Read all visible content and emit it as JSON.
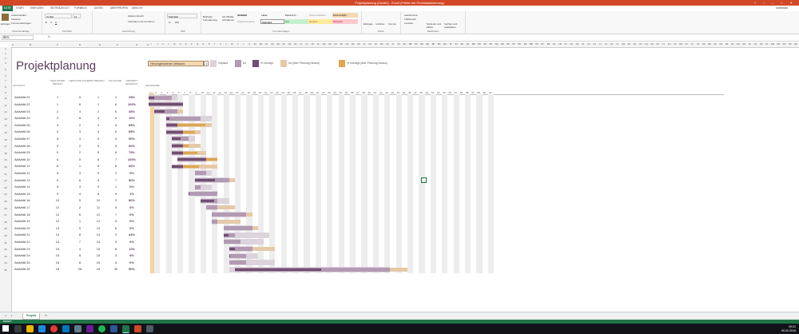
{
  "window": {
    "title": "Projektplanung (Gantt1) - Excel (Fehler bei Produktaktivierung)",
    "user": "damedaild"
  },
  "ribbon": {
    "tabs": [
      "DATEI",
      "START",
      "EINFÜGEN",
      "SEITENLAYOUT",
      "FORMELN",
      "DATEN",
      "ÜBERPRÜFEN",
      "ANSICHT"
    ],
    "active_tab": "START",
    "groups": [
      {
        "label": "Zwischenablage",
        "items": [
          "Einfügen",
          "Ausschneiden",
          "Kopieren",
          "Format übertragen"
        ]
      },
      {
        "label": "Schriftart",
        "items": [
          "Corbel",
          "11",
          "F",
          "K",
          "U"
        ]
      },
      {
        "label": "Ausrichtung",
        "items": [
          "Zeilenumbruch",
          "Verbinden und zentrieren"
        ]
      },
      {
        "label": "Zahl",
        "items": [
          "Standard",
          "%",
          "000"
        ]
      },
      {
        "label": "Formatvorlagen",
        "items": [
          "Bedingte Formatierung",
          "Als Tabelle formatieren"
        ]
      },
      {
        "label": "Zellen",
        "items": [
          "Einfügen",
          "Löschen",
          "Format"
        ]
      },
      {
        "label": "Bearbeiten",
        "items": [
          "AutoSumme",
          "Füllbereich",
          "Löschen",
          "Sortieren und Filtern",
          "Suchen und Auswählen"
        ]
      }
    ],
    "styles": [
      "Aktivität",
      "Label",
      "Percent C...",
      "Period Headers",
      "Period Highl...",
      "Projekt Headers",
      "Standard",
      "Gut",
      "Neutral",
      "Schlecht"
    ]
  },
  "formula_bar": {
    "name_box": "BE21",
    "fx_label": "fx",
    "value": ""
  },
  "sheet": {
    "title": "Projektplanung",
    "period_label": "Hervorgehobener Zeitraum:",
    "period_value": "1",
    "legend": [
      {
        "label": "Geplant",
        "color": "#dcd3dc"
      },
      {
        "label": "Ist",
        "color": "#b39ab3"
      },
      {
        "label": "% erledigt",
        "color": "#6f4e6f"
      },
      {
        "label": "Ist (über Planung hinaus)",
        "color": "#e5c9a8"
      },
      {
        "label": "% erledigt (über Planung hinaus)",
        "color": "#dea64f"
      }
    ],
    "headers": {
      "activity": "AKTIVITÄT",
      "plan_start": "GEPLANTER BEGINN",
      "plan_duration": "GEPLANTE DAUER",
      "actual_start": "IST-BEGINN",
      "actual_duration": "IST-DAUER",
      "percent": "PROZENT ERLEDIGT",
      "periods": "ZEITRÄUME"
    },
    "period_count": 60,
    "rows": [
      {
        "name": "Aktivität 01",
        "ps": 1,
        "pd": 5,
        "as": 1,
        "ad": 4,
        "pct": "25%"
      },
      {
        "name": "Aktivität 02",
        "ps": 1,
        "pd": 6,
        "as": 1,
        "ad": 6,
        "pct": "100%"
      },
      {
        "name": "Aktivität 03",
        "ps": 2,
        "pd": 4,
        "as": 2,
        "ad": 5,
        "pct": "35%"
      },
      {
        "name": "Aktivität 04",
        "ps": 4,
        "pd": 8,
        "as": 4,
        "ad": 6,
        "pct": "10%"
      },
      {
        "name": "Aktivität 05",
        "ps": 4,
        "pd": 2,
        "as": 4,
        "ad": 8,
        "pct": "85%"
      },
      {
        "name": "Aktivität 06",
        "ps": 4,
        "pd": 3,
        "as": 4,
        "ad": 6,
        "pct": "85%"
      },
      {
        "name": "Aktivität 07",
        "ps": 5,
        "pd": 4,
        "as": 5,
        "ad": 3,
        "pct": "50%"
      },
      {
        "name": "Aktivität 08",
        "ps": 5,
        "pd": 2,
        "as": 5,
        "ad": 5,
        "pct": "60%"
      },
      {
        "name": "Aktivität 09",
        "ps": 5,
        "pd": 2,
        "as": 5,
        "ad": 6,
        "pct": "75%"
      },
      {
        "name": "Aktivität 10",
        "ps": 6,
        "pd": 5,
        "as": 6,
        "ad": 7,
        "pct": "100%"
      },
      {
        "name": "Aktivität 11",
        "ps": 6,
        "pd": 1,
        "as": 5,
        "ad": 8,
        "pct": "60%"
      },
      {
        "name": "Aktivität 12",
        "ps": 9,
        "pd": 3,
        "as": 9,
        "ad": 2,
        "pct": "0%"
      },
      {
        "name": "Aktivität 13",
        "ps": 9,
        "pd": 6,
        "as": 9,
        "ad": 7,
        "pct": "50%"
      },
      {
        "name": "Aktivität 14",
        "ps": 9,
        "pd": 3,
        "as": 9,
        "ad": 1,
        "pct": "0%"
      },
      {
        "name": "Aktivität 15",
        "ps": 9,
        "pd": 4,
        "as": 8,
        "ad": 5,
        "pct": "1%"
      },
      {
        "name": "Aktivität 16",
        "ps": 10,
        "pd": 5,
        "as": 10,
        "ad": 3,
        "pct": "80%"
      },
      {
        "name": "Aktivität 17",
        "ps": 11,
        "pd": 2,
        "as": 11,
        "ad": 5,
        "pct": "0%"
      },
      {
        "name": "Aktivität 18",
        "ps": 12,
        "pd": 6,
        "as": 12,
        "ad": 7,
        "pct": "0%"
      },
      {
        "name": "Aktivität 19",
        "ps": 12,
        "pd": 1,
        "as": 12,
        "ad": 5,
        "pct": "0%"
      },
      {
        "name": "Aktivität 20",
        "ps": 14,
        "pd": 5,
        "as": 14,
        "ad": 6,
        "pct": "0%"
      },
      {
        "name": "Aktivität 21",
        "ps": 14,
        "pd": 8,
        "as": 14,
        "ad": 2,
        "pct": "44%"
      },
      {
        "name": "Aktivität 22",
        "ps": 14,
        "pd": 7,
        "as": 14,
        "ad": 3,
        "pct": "0%"
      },
      {
        "name": "Aktivität 23",
        "ps": 15,
        "pd": 4,
        "as": 15,
        "ad": 8,
        "pct": "12%"
      },
      {
        "name": "Aktivität 24",
        "ps": 15,
        "pd": 5,
        "as": 15,
        "ad": 3,
        "pct": "5%"
      },
      {
        "name": "Aktivität 25",
        "ps": 15,
        "pd": 8,
        "as": 15,
        "ad": 3,
        "pct": "0%"
      },
      {
        "name": "Aktivität 26",
        "ps": 15,
        "pd": 28,
        "as": 16,
        "ad": 30,
        "pct": "50%"
      }
    ]
  },
  "sheet_tabs": [
    "Projekt"
  ],
  "status": "BEREIT",
  "clock": {
    "time": "09:21",
    "date": "09.02.2016"
  }
}
